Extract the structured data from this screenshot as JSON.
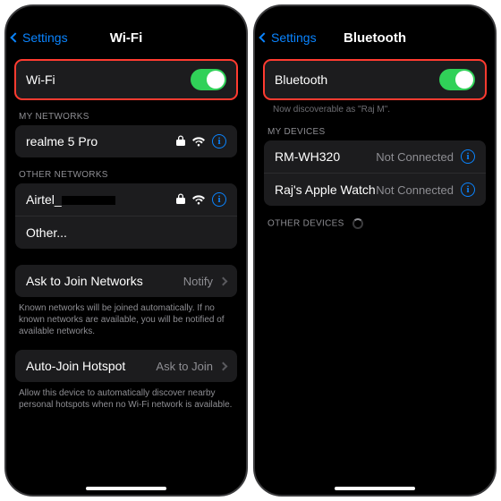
{
  "left": {
    "back": "Settings",
    "title": "Wi-Fi",
    "toggle_label": "Wi-Fi",
    "my_networks_header": "MY NETWORKS",
    "network1": "realme 5 Pro",
    "other_networks_header": "OTHER NETWORKS",
    "network2_prefix": "Airtel_",
    "other_label": "Other...",
    "ask_label": "Ask to Join Networks",
    "ask_value": "Notify",
    "ask_footnote": "Known networks will be joined automatically. If no known networks are available, you will be notified of available networks.",
    "hotspot_label": "Auto-Join Hotspot",
    "hotspot_value": "Ask to Join",
    "hotspot_footnote": "Allow this device to automatically discover nearby personal hotspots when no Wi-Fi network is available."
  },
  "right": {
    "back": "Settings",
    "title": "Bluetooth",
    "toggle_label": "Bluetooth",
    "discoverable": "Now discoverable as \"Raj M\".",
    "my_devices_header": "MY DEVICES",
    "dev1_name": "RM-WH320",
    "dev1_status": "Not Connected",
    "dev2_name": "Raj's Apple Watch",
    "dev2_status": "Not Connected",
    "other_devices_header": "OTHER DEVICES"
  }
}
